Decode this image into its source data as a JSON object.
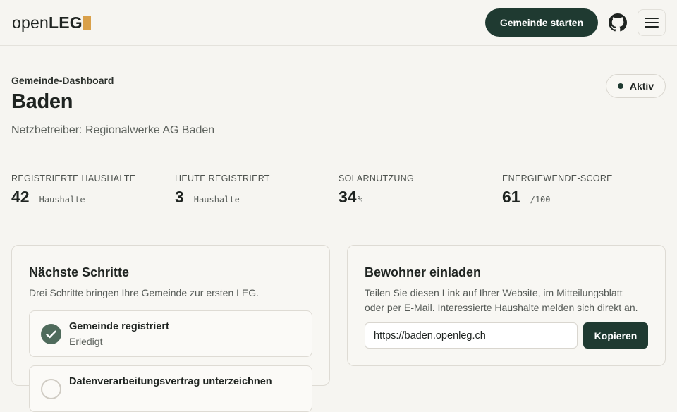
{
  "header": {
    "logo_text_regular": "open",
    "logo_text_bold": "LEG",
    "cta_label": "Gemeinde starten",
    "github_icon": "github-icon",
    "menu_icon": "hamburger-menu-icon"
  },
  "dashboard": {
    "eyebrow": "Gemeinde-Dashboard",
    "title": "Baden",
    "subtitle": "Netzbetreiber: Regionalwerke AG Baden",
    "status_label": "Aktiv"
  },
  "stats": [
    {
      "label": "REGISTRIERTE HAUSHALTE",
      "value": "42",
      "unit": "Haushalte"
    },
    {
      "label": "HEUTE REGISTRIERT",
      "value": "3",
      "unit": "Haushalte"
    },
    {
      "label": "SOLARNUTZUNG",
      "value": "34",
      "unit": "%"
    },
    {
      "label": "ENERGIEWENDE-SCORE",
      "value": "61",
      "unit": "/100"
    }
  ],
  "next_steps": {
    "title": "Nächste Schritte",
    "description": "Drei Schritte bringen Ihre Gemeinde zur ersten LEG.",
    "steps": [
      {
        "title": "Gemeinde registriert",
        "status": "Erledigt"
      },
      {
        "title": "Datenverarbeitungsvertrag unterzeichnen",
        "status": ""
      }
    ]
  },
  "invite": {
    "title": "Bewohner einladen",
    "description_line1": "Teilen Sie diesen Link auf Ihrer Website, im Mitteilungsblatt",
    "description_line2": "oder per E-Mail. Interessierte Haushalte melden sich direkt an.",
    "link_value": "https://baden.openleg.ch",
    "copy_label": "Kopieren"
  },
  "colors": {
    "background": "#f6f5f1",
    "primary": "#1f3a31",
    "logo_accent": "#d9a04a",
    "check_fill": "#4f6b5c"
  }
}
